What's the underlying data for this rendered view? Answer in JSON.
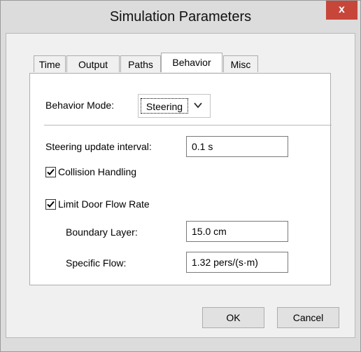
{
  "window": {
    "title": "Simulation Parameters",
    "close_label": "x"
  },
  "tabs": [
    {
      "label": "Time"
    },
    {
      "label": "Output"
    },
    {
      "label": "Paths"
    },
    {
      "label": "Behavior",
      "active": true
    },
    {
      "label": "Misc"
    }
  ],
  "behavior": {
    "mode_label": "Behavior Mode:",
    "mode_value": "Steering",
    "steering_interval_label": "Steering update interval:",
    "steering_interval_value": "0.1 s",
    "collision_label": "Collision Handling",
    "collision_checked": true,
    "limit_door_label": "Limit Door Flow Rate",
    "limit_door_checked": true,
    "boundary_layer_label": "Boundary Layer:",
    "boundary_layer_value": "15.0 cm",
    "specific_flow_label": "Specific Flow:",
    "specific_flow_value": "1.32 pers/(s·m)"
  },
  "buttons": {
    "ok": "OK",
    "cancel": "Cancel"
  },
  "colors": {
    "close_bg": "#c7463a",
    "frame_bg": "#f0f0f0",
    "titlebar_bg": "#dcdcdc"
  },
  "icons": {
    "close": "close-icon",
    "dropdown": "chevron-down-icon",
    "check": "checkmark-icon"
  }
}
